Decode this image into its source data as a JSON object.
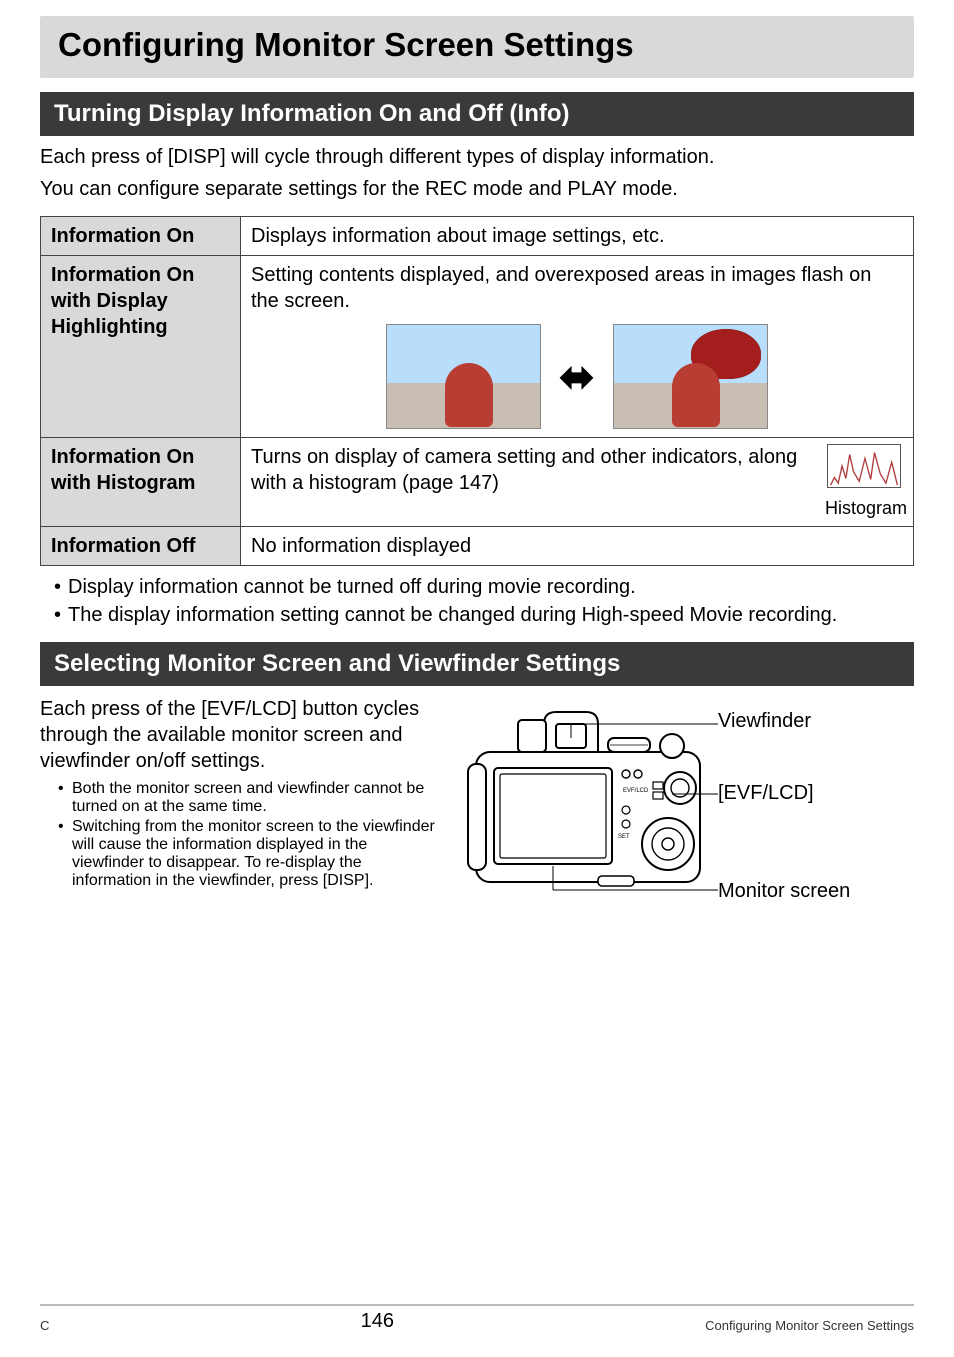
{
  "title": "Configuring Monitor Screen Settings",
  "section1": {
    "heading": "Turning Display Information On and Off (Info)",
    "intro1": "Each press of [DISP] will cycle through different types of display information.",
    "intro2": "You can configure separate settings for the REC mode and PLAY mode.",
    "rows": [
      {
        "label": "Information On",
        "desc": "Displays information about image settings, etc."
      },
      {
        "label": "Information On with Display Highlighting",
        "desc": "Setting contents displayed, and overexposed areas in images flash on the screen."
      },
      {
        "label": "Information On with Histogram",
        "desc": "Turns on display of camera setting and other indicators, along with a histogram (page 147)",
        "caption": "Histogram"
      },
      {
        "label": "Information Off",
        "desc": "No information displayed"
      }
    ],
    "notes": [
      "Display information cannot be turned off during movie recording.",
      "The display information setting cannot be changed during High-speed Movie recording."
    ]
  },
  "section2": {
    "heading": "Selecting Monitor Screen and Viewfinder Settings",
    "intro": "Each press of the [EVF/LCD] button cycles through the available monitor screen and viewfinder on/off settings.",
    "bullets": [
      "Both the monitor screen and viewfinder cannot be turned on at the same time.",
      "Switching from the monitor screen to the viewfinder will cause the information displayed in the viewfinder to disappear. To re-display the information in the viewfinder, press [DISP]."
    ],
    "callouts": {
      "viewfinder": "Viewfinder",
      "evf_lcd": "[EVF/LCD]",
      "monitor": "Monitor screen"
    }
  },
  "footer": {
    "left": "C",
    "page": "146",
    "right": "Configuring Monitor Screen Settings"
  }
}
